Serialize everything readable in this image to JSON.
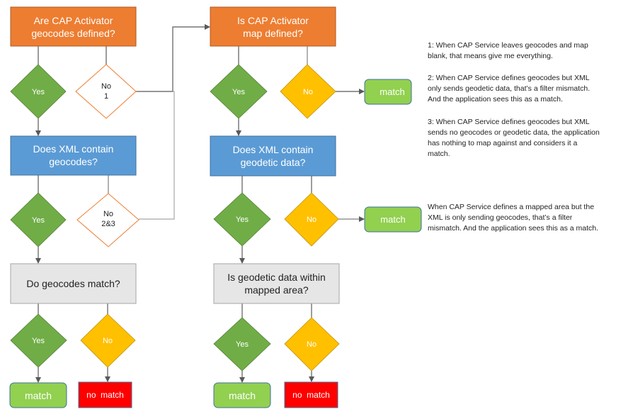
{
  "colors": {
    "orange": "#ED7D31",
    "orange_border": "#AE5A21",
    "blue": "#5B9BD5",
    "blue_border": "#41719C",
    "gray": "#E7E6E6",
    "gray_border": "#A5A5A5",
    "green_diamond": "#70AD47",
    "yellow_diamond": "#FFC000",
    "match_green": "#92D050",
    "match_border": "#41719C",
    "no_match_red": "#FF0000",
    "connector": "#595959"
  },
  "left_flow": {
    "q1": {
      "line1": "Are CAP Activator",
      "line2": "geocodes defined?"
    },
    "q1_yes": "Yes",
    "q1_no": {
      "line1": "No",
      "line2": "1"
    },
    "q2": {
      "line1": "Does XML contain",
      "line2": "geocodes?"
    },
    "q2_yes": "Yes",
    "q2_no": {
      "line1": "No",
      "line2": "2&3"
    },
    "q3": {
      "line1": "Do geocodes match?"
    },
    "q3_yes": "Yes",
    "q3_no": "No",
    "result_match": "match",
    "result_no_match": "no  match"
  },
  "right_flow": {
    "q1": {
      "line1": "Is CAP Activator",
      "line2": "map defined?"
    },
    "q1_yes": "Yes",
    "q1_no": "No",
    "q1_no_result": "match",
    "q2": {
      "line1": "Does XML contain",
      "line2": "geodetic data?"
    },
    "q2_yes": "Yes",
    "q2_no": "No",
    "q2_no_result": "match",
    "q3": {
      "line1": "Is geodetic data within",
      "line2": "mapped area?"
    },
    "q3_yes": "Yes",
    "q3_no": "No",
    "result_match": "match",
    "result_no_match": "no  match"
  },
  "notes": {
    "note1": [
      "1: When CAP Service leaves geocodes and map",
      "blank, that means give me everything."
    ],
    "note2": [
      "2: When CAP Service defines geocodes but XML",
      "only sends geodetic data, that’s a filter mismatch.",
      "And the application sees this as a match."
    ],
    "note3": [
      "3: When CAP Service defines geocodes but XML",
      "sends no geocodes or geodetic data, the application",
      "has nothing to map against and considers it a",
      "match."
    ],
    "note4": [
      "When CAP Service defines a mapped area but the",
      "XML is only sending geocodes, that’s a filter",
      "mismatch. And the application sees this as a match."
    ]
  }
}
